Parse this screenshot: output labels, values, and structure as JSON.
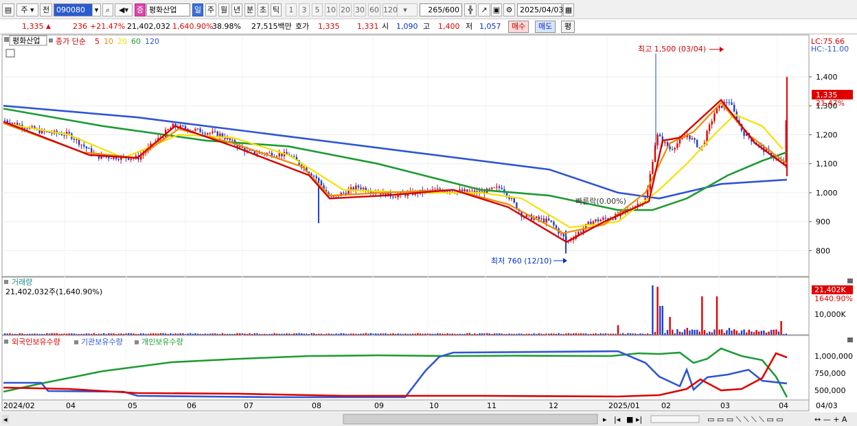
{
  "toolbar": {
    "market_label": "주",
    "prev_label": "전",
    "code": "090080",
    "stock_name": "평화산업",
    "period_tabs": [
      "일",
      "주",
      "월",
      "년",
      "분",
      "초",
      "틱"
    ],
    "interval_tabs": [
      "1",
      "3",
      "5",
      "10",
      "20",
      "30",
      "60",
      "120"
    ],
    "count": "265",
    "count_max": "/600",
    "date": "2025/04/03"
  },
  "quote": {
    "price": "1,335",
    "change": "236",
    "change_pct": "+21.47%",
    "volume": "21,402,032",
    "volume_pct": "1,640.90%",
    "turnover": "38.98%",
    "amount": "27,515백만",
    "ask_label": "호가",
    "ask": "1,335",
    "bid": "1,331",
    "open_label": "시",
    "open": "1,090",
    "high_label": "고",
    "high": "1,400",
    "low_label": "저",
    "low": "1,057",
    "buy_label": "매수",
    "sell_label": "매도",
    "eval_label": "평"
  },
  "price_panel": {
    "title": "평화산업",
    "ma_label": "종가 단순",
    "ma_periods": [
      "5",
      "10",
      "20",
      "60",
      "120"
    ],
    "ma_colors": [
      "#d40000",
      "#f08a00",
      "#f2e200",
      "#1e9b33",
      "#2f55d4"
    ],
    "lc": "LC:75.66",
    "hc": "HC:-11.00",
    "price_box": "1,335",
    "pct_box": "21.47%",
    "max_annot": "최고 1,500 (03/04)",
    "min_annot": "최저 760 (12/10)",
    "overlay_annot": "빠른락(0.00%)",
    "y_ticks": [
      "1,400",
      "1,300",
      "1,200",
      "1,100",
      "1,000",
      "900",
      "800"
    ]
  },
  "volume_panel": {
    "title": "거래량",
    "subtitle": "21,402,032주(1,640.90%)",
    "value_box": "21,402K",
    "pct_box": "1640.90%",
    "y_ticks": [
      "10,000K"
    ]
  },
  "holdings_panel": {
    "series": [
      "외국인보유수량",
      "기관보유수량",
      "개인보유수량"
    ],
    "colors": [
      "#e00000",
      "#2f55d4",
      "#1e9b33"
    ],
    "y_ticks": [
      "1,000,000",
      "750,000",
      "500,000"
    ]
  },
  "x_axis": {
    "labels": [
      "2024/02",
      "04",
      "05",
      "06",
      "07",
      "08",
      "09",
      "10",
      "11",
      "12",
      "2025/01",
      "02",
      "03",
      "04"
    ],
    "right_label": "04/03"
  },
  "chart_data": {
    "type": "line",
    "series": [
      {
        "name": "종가",
        "x": [
          "2024/02",
          "2024/03",
          "2024/04",
          "2024/05",
          "2024/06",
          "2024/07",
          "2024/08",
          "2024/09",
          "2024/10",
          "2024/11",
          "2024/12",
          "2025/01",
          "2025/02",
          "2025/03",
          "2025/04"
        ],
        "values": [
          1250,
          1200,
          1130,
          1200,
          1190,
          1120,
          1000,
          1000,
          1010,
          1000,
          800,
          930,
          1200,
          1300,
          1335
        ]
      },
      {
        "name": "120",
        "x": [
          "2024/02",
          "2024/05",
          "2024/08",
          "2024/11",
          "2025/01",
          "2025/04"
        ],
        "values": [
          1300,
          1240,
          1160,
          1080,
          980,
          1045
        ]
      }
    ],
    "ylim": [
      760,
      1500
    ]
  }
}
